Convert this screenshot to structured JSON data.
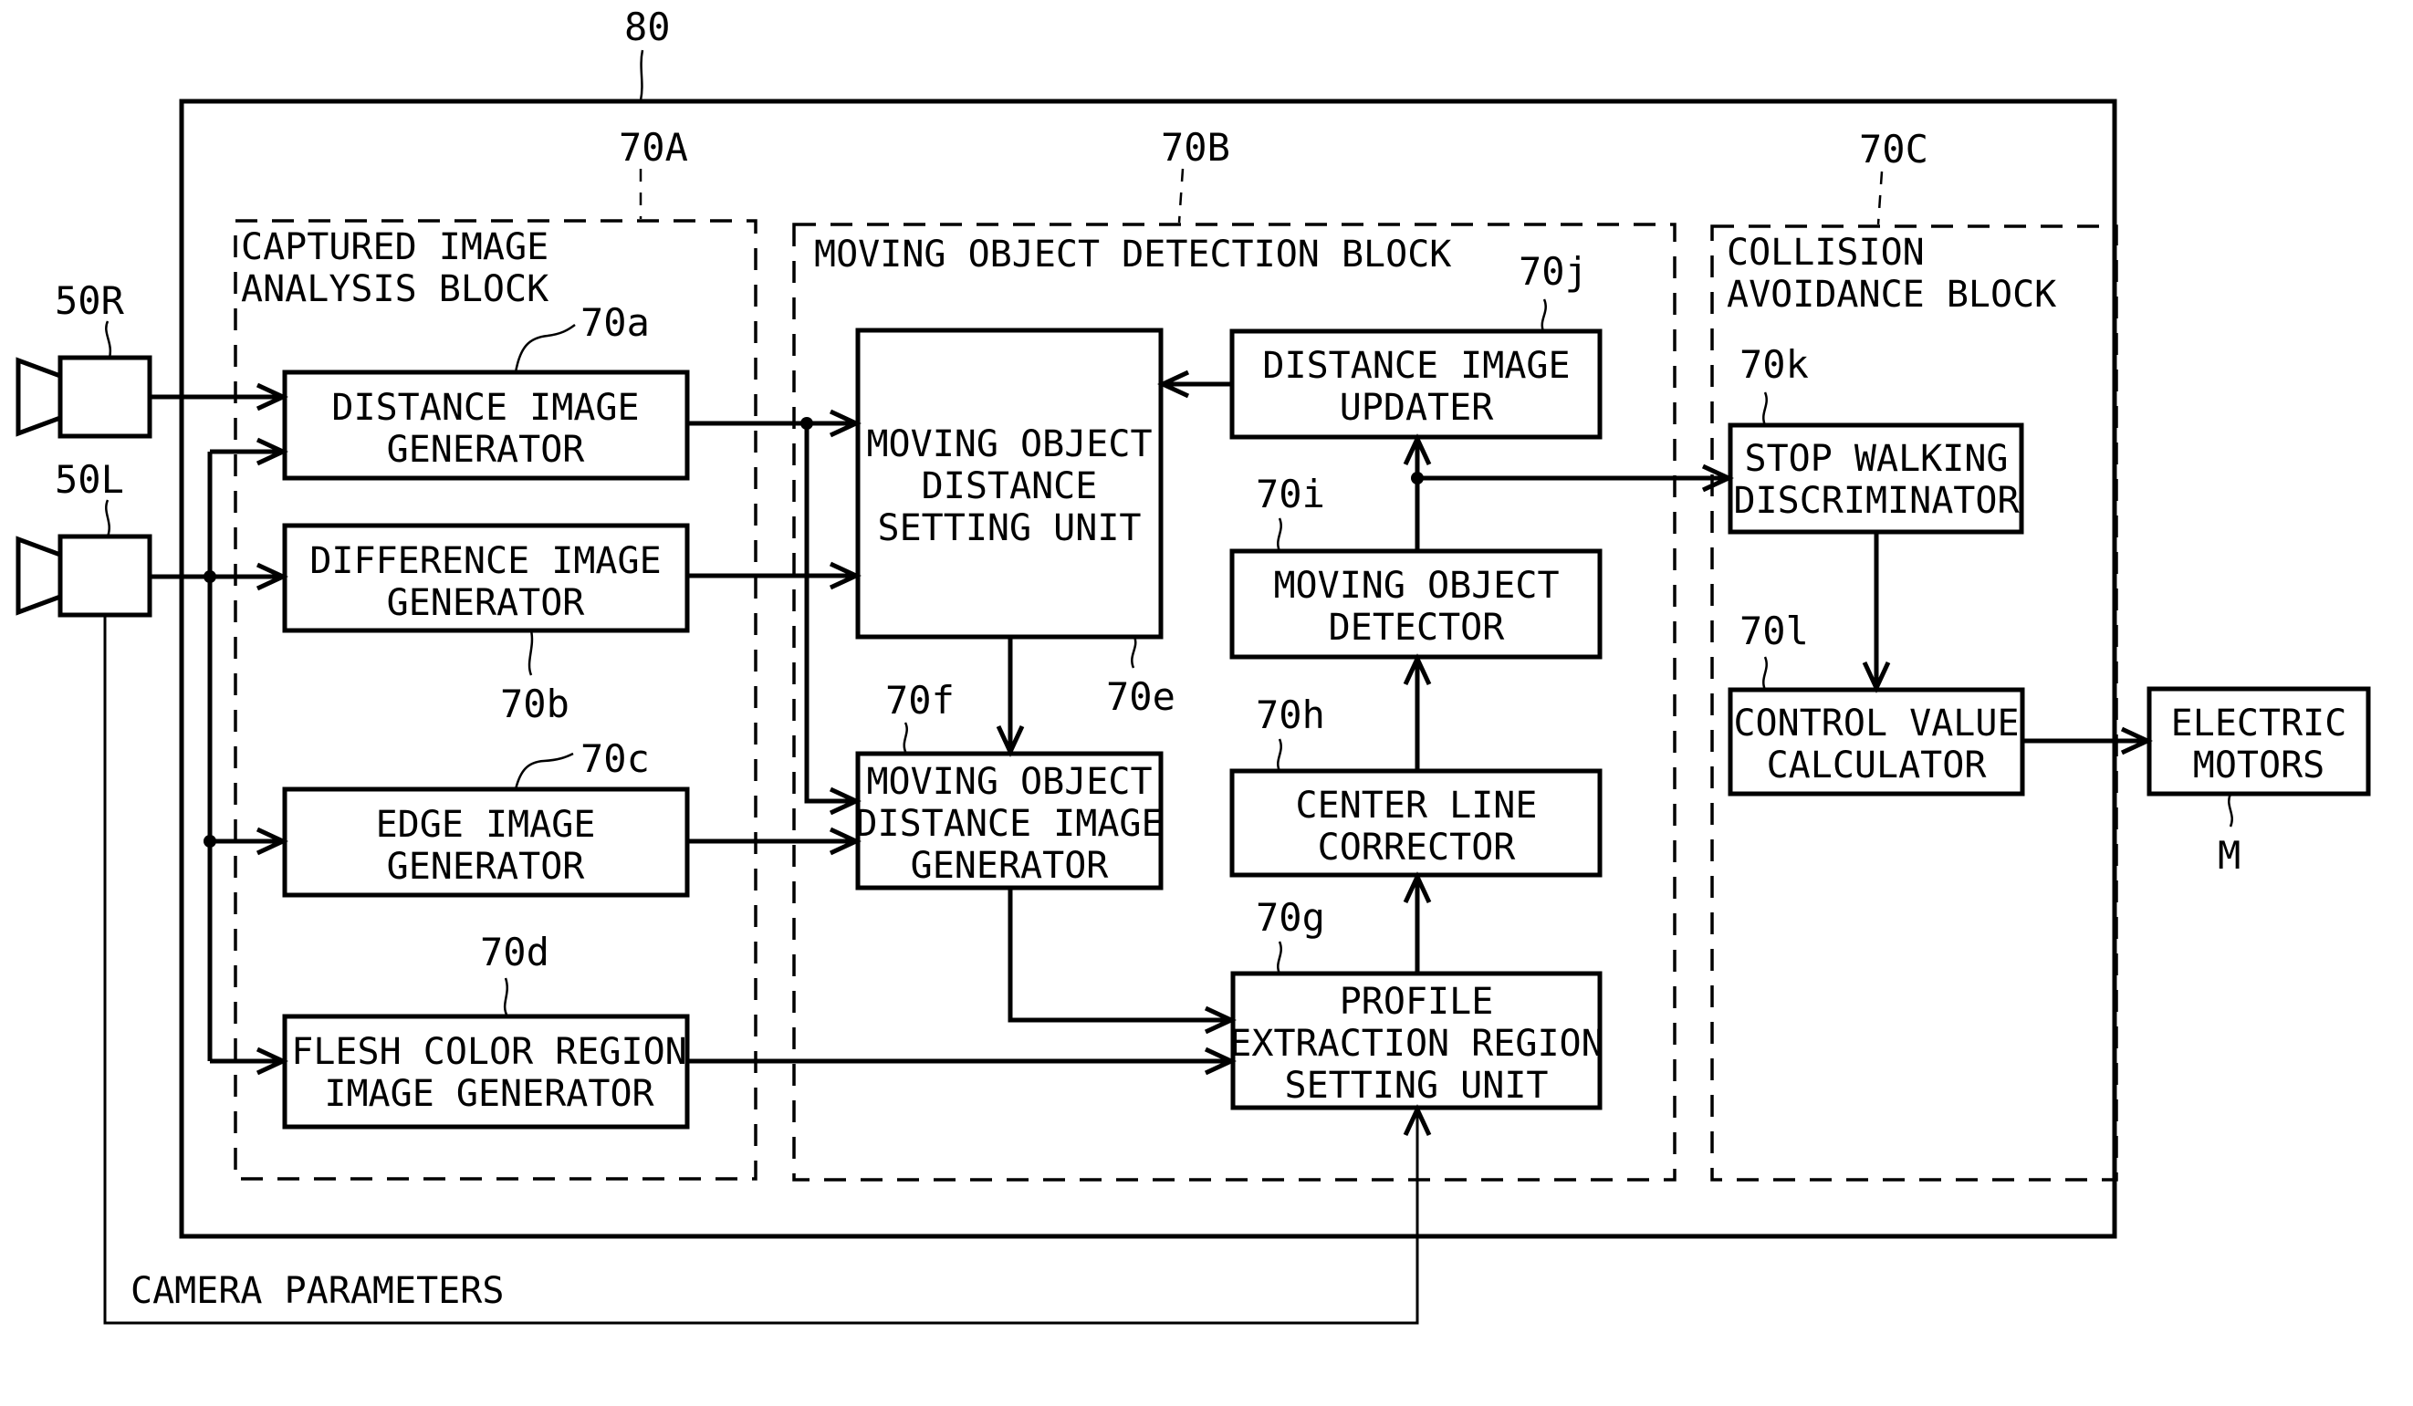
{
  "figure": {
    "system_ref": "80",
    "blocks": {
      "A": {
        "ref": "70A",
        "title": [
          "CAPTURED IMAGE",
          "ANALYSIS BLOCK"
        ]
      },
      "B": {
        "ref": "70B",
        "title": [
          "MOVING OBJECT DETECTION BLOCK"
        ]
      },
      "C": {
        "ref": "70C",
        "title": [
          "COLLISION",
          "AVOIDANCE BLOCK"
        ]
      }
    },
    "cameras": {
      "right": {
        "ref": "50R"
      },
      "left": {
        "ref": "50L"
      }
    },
    "units": {
      "a": {
        "ref": "70a",
        "label": [
          "DISTANCE IMAGE",
          "GENERATOR"
        ]
      },
      "b": {
        "ref": "70b",
        "label": [
          "DIFFERENCE IMAGE",
          "GENERATOR"
        ]
      },
      "c": {
        "ref": "70c",
        "label": [
          "EDGE IMAGE",
          "GENERATOR"
        ]
      },
      "d": {
        "ref": "70d",
        "label": [
          "FLESH COLOR REGION",
          "IMAGE GENERATOR"
        ]
      },
      "e": {
        "ref": "70e",
        "label": [
          "MOVING OBJECT",
          "DISTANCE",
          "SETTING UNIT"
        ]
      },
      "f": {
        "ref": "70f",
        "label": [
          "MOVING OBJECT",
          "DISTANCE IMAGE",
          "GENERATOR"
        ]
      },
      "g": {
        "ref": "70g",
        "label": [
          "PROFILE",
          "EXTRACTION REGION",
          "SETTING UNIT"
        ]
      },
      "h": {
        "ref": "70h",
        "label": [
          "CENTER LINE",
          "CORRECTOR"
        ]
      },
      "i": {
        "ref": "70i",
        "label": [
          "MOVING OBJECT",
          "DETECTOR"
        ]
      },
      "j": {
        "ref": "70j",
        "label": [
          "DISTANCE IMAGE",
          "UPDATER"
        ]
      },
      "k": {
        "ref": "70k",
        "label": [
          "STOP WALKING",
          "DISCRIMINATOR"
        ]
      },
      "l": {
        "ref": "70l",
        "label": [
          "CONTROL VALUE",
          "CALCULATOR"
        ]
      }
    },
    "motors": {
      "ref": "M",
      "label": [
        "ELECTRIC",
        "MOTORS"
      ]
    },
    "camera_parameters_label": "CAMERA PARAMETERS"
  }
}
